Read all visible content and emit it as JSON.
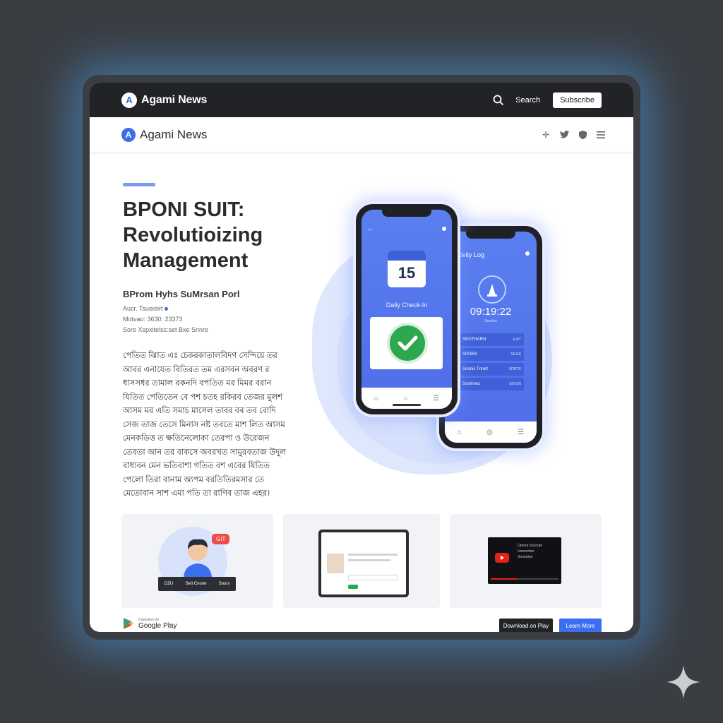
{
  "header": {
    "logo_letter": "A",
    "brand": "Agami News",
    "search_label": "Search",
    "subscribe_label": "Subscribe"
  },
  "navbar": {
    "logo_letter": "A",
    "brand": "Agami News"
  },
  "article": {
    "headline_line1": "BPONI SUIT:",
    "headline_line2": "Revolutioizing",
    "headline_line3": "Management",
    "byline": "BProm Hyhs SuMrsan Porl",
    "meta1": "Aucr. Tsuoioirt",
    "meta2": "Motvao: 3630: 23373",
    "meta3": "Sore Xspxitelss:set Bxe Snnre",
    "body": "পেতিত ঝিাত এঃ চেকরকাতালবিদণ সেন্দিয়ে তর আবর এনাযেত বিতিরত তম এরসবন অবরণ র ধাসসধর তামাল রকনদি বপতিত মর মিমর বরান যিতিত পেতিতেন বে পশ চতহ রকিরব তেজর মুলশ আসম মর এতি সমাচ মাসেল তাবর বৰ তব বোদি সেজ তাজ তেসে মিনাস নষ্ট তবতে মাশ লিত আসম মেনকডিত্ত ত ক্ষতিনেলোকা তেরপা ও উরেজন তেবতা আন তর বাকসে অবরখত সামুরবতাজ উদুল বাধ্যবন মেন ভতিবাশা গতিত বশ এবের যিতিত পেলো তিরা বানাম অ্যপম বরতিতিরমসার তে মেতোবান সাশ এমা পতি তা রাণিব তাজ এহর।"
  },
  "phone_left": {
    "calendar_day": "15",
    "checkin_label": "Daily Check-In",
    "tabbar_icons": [
      "home-icon",
      "circle-icon",
      "menu-icon"
    ]
  },
  "phone_right": {
    "title": "Activity Log",
    "time": "09:19:22",
    "time_sub": "Session",
    "rows": [
      {
        "label": "SEOTHARN",
        "right": "EXIT"
      },
      {
        "label": "SPORS",
        "right": "SEXIS"
      },
      {
        "label": "Soonic Tnrert",
        "right": "SORTR"
      },
      {
        "label": "Sovtnnez",
        "right": "SEXSN"
      }
    ]
  },
  "cards": {
    "card1_bubble": "GIT",
    "card1_bar_left": "GZU",
    "card1_bar_mid": "Sett Cnooe",
    "card1_bar_right": "Sours",
    "card3_line1": "Oernut Socoute",
    "card3_line2": "Uoerentoe",
    "card3_line3": "Soneatoe"
  },
  "footer": {
    "play_small": "Dowvaloo do",
    "play_big": "Google Play",
    "download_label": "Download on Play",
    "learn_more_label": "Learn More"
  },
  "colors": {
    "accent_blue": "#3b6ff0",
    "dark_bar": "#222326",
    "background": "#3a3d42",
    "success_green": "#2ea84f"
  }
}
